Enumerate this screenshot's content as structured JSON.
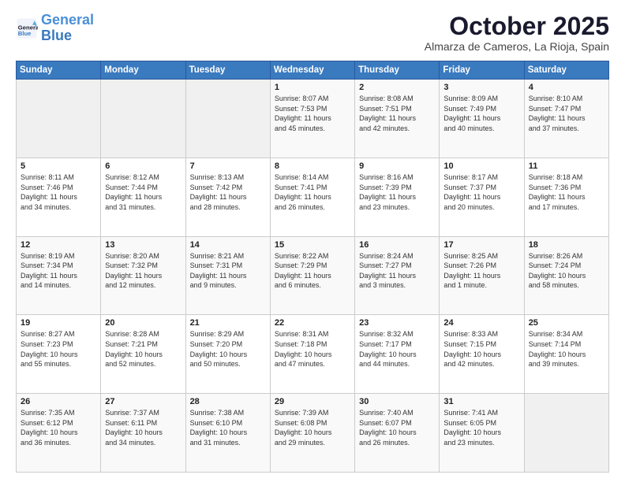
{
  "logo": {
    "line1": "General",
    "line2": "Blue"
  },
  "header": {
    "month": "October 2025",
    "location": "Almarza de Cameros, La Rioja, Spain"
  },
  "weekdays": [
    "Sunday",
    "Monday",
    "Tuesday",
    "Wednesday",
    "Thursday",
    "Friday",
    "Saturday"
  ],
  "weeks": [
    [
      {
        "day": "",
        "info": ""
      },
      {
        "day": "",
        "info": ""
      },
      {
        "day": "",
        "info": ""
      },
      {
        "day": "1",
        "info": "Sunrise: 8:07 AM\nSunset: 7:53 PM\nDaylight: 11 hours\nand 45 minutes."
      },
      {
        "day": "2",
        "info": "Sunrise: 8:08 AM\nSunset: 7:51 PM\nDaylight: 11 hours\nand 42 minutes."
      },
      {
        "day": "3",
        "info": "Sunrise: 8:09 AM\nSunset: 7:49 PM\nDaylight: 11 hours\nand 40 minutes."
      },
      {
        "day": "4",
        "info": "Sunrise: 8:10 AM\nSunset: 7:47 PM\nDaylight: 11 hours\nand 37 minutes."
      }
    ],
    [
      {
        "day": "5",
        "info": "Sunrise: 8:11 AM\nSunset: 7:46 PM\nDaylight: 11 hours\nand 34 minutes."
      },
      {
        "day": "6",
        "info": "Sunrise: 8:12 AM\nSunset: 7:44 PM\nDaylight: 11 hours\nand 31 minutes."
      },
      {
        "day": "7",
        "info": "Sunrise: 8:13 AM\nSunset: 7:42 PM\nDaylight: 11 hours\nand 28 minutes."
      },
      {
        "day": "8",
        "info": "Sunrise: 8:14 AM\nSunset: 7:41 PM\nDaylight: 11 hours\nand 26 minutes."
      },
      {
        "day": "9",
        "info": "Sunrise: 8:16 AM\nSunset: 7:39 PM\nDaylight: 11 hours\nand 23 minutes."
      },
      {
        "day": "10",
        "info": "Sunrise: 8:17 AM\nSunset: 7:37 PM\nDaylight: 11 hours\nand 20 minutes."
      },
      {
        "day": "11",
        "info": "Sunrise: 8:18 AM\nSunset: 7:36 PM\nDaylight: 11 hours\nand 17 minutes."
      }
    ],
    [
      {
        "day": "12",
        "info": "Sunrise: 8:19 AM\nSunset: 7:34 PM\nDaylight: 11 hours\nand 14 minutes."
      },
      {
        "day": "13",
        "info": "Sunrise: 8:20 AM\nSunset: 7:32 PM\nDaylight: 11 hours\nand 12 minutes."
      },
      {
        "day": "14",
        "info": "Sunrise: 8:21 AM\nSunset: 7:31 PM\nDaylight: 11 hours\nand 9 minutes."
      },
      {
        "day": "15",
        "info": "Sunrise: 8:22 AM\nSunset: 7:29 PM\nDaylight: 11 hours\nand 6 minutes."
      },
      {
        "day": "16",
        "info": "Sunrise: 8:24 AM\nSunset: 7:27 PM\nDaylight: 11 hours\nand 3 minutes."
      },
      {
        "day": "17",
        "info": "Sunrise: 8:25 AM\nSunset: 7:26 PM\nDaylight: 11 hours\nand 1 minute."
      },
      {
        "day": "18",
        "info": "Sunrise: 8:26 AM\nSunset: 7:24 PM\nDaylight: 10 hours\nand 58 minutes."
      }
    ],
    [
      {
        "day": "19",
        "info": "Sunrise: 8:27 AM\nSunset: 7:23 PM\nDaylight: 10 hours\nand 55 minutes."
      },
      {
        "day": "20",
        "info": "Sunrise: 8:28 AM\nSunset: 7:21 PM\nDaylight: 10 hours\nand 52 minutes."
      },
      {
        "day": "21",
        "info": "Sunrise: 8:29 AM\nSunset: 7:20 PM\nDaylight: 10 hours\nand 50 minutes."
      },
      {
        "day": "22",
        "info": "Sunrise: 8:31 AM\nSunset: 7:18 PM\nDaylight: 10 hours\nand 47 minutes."
      },
      {
        "day": "23",
        "info": "Sunrise: 8:32 AM\nSunset: 7:17 PM\nDaylight: 10 hours\nand 44 minutes."
      },
      {
        "day": "24",
        "info": "Sunrise: 8:33 AM\nSunset: 7:15 PM\nDaylight: 10 hours\nand 42 minutes."
      },
      {
        "day": "25",
        "info": "Sunrise: 8:34 AM\nSunset: 7:14 PM\nDaylight: 10 hours\nand 39 minutes."
      }
    ],
    [
      {
        "day": "26",
        "info": "Sunrise: 7:35 AM\nSunset: 6:12 PM\nDaylight: 10 hours\nand 36 minutes."
      },
      {
        "day": "27",
        "info": "Sunrise: 7:37 AM\nSunset: 6:11 PM\nDaylight: 10 hours\nand 34 minutes."
      },
      {
        "day": "28",
        "info": "Sunrise: 7:38 AM\nSunset: 6:10 PM\nDaylight: 10 hours\nand 31 minutes."
      },
      {
        "day": "29",
        "info": "Sunrise: 7:39 AM\nSunset: 6:08 PM\nDaylight: 10 hours\nand 29 minutes."
      },
      {
        "day": "30",
        "info": "Sunrise: 7:40 AM\nSunset: 6:07 PM\nDaylight: 10 hours\nand 26 minutes."
      },
      {
        "day": "31",
        "info": "Sunrise: 7:41 AM\nSunset: 6:05 PM\nDaylight: 10 hours\nand 23 minutes."
      },
      {
        "day": "",
        "info": ""
      }
    ]
  ]
}
